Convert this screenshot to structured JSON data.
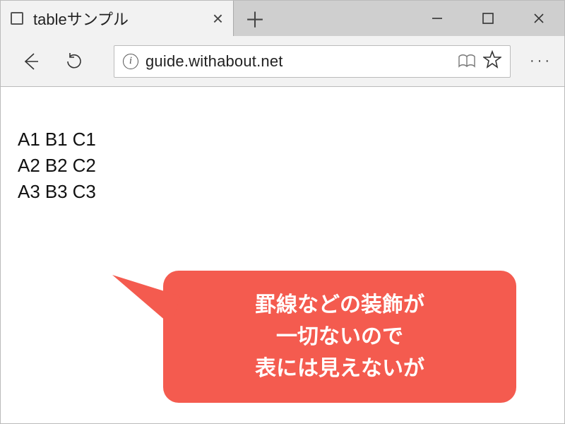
{
  "tab": {
    "title": "tableサンプル"
  },
  "url": "guide.withabout.net",
  "table": {
    "rows": [
      {
        "c0": "A1",
        "c1": "B1",
        "c2": "C1"
      },
      {
        "c0": "A2",
        "c1": "B2",
        "c2": "C2"
      },
      {
        "c0": "A3",
        "c1": "B3",
        "c2": "C3"
      }
    ]
  },
  "callout": {
    "line1": "罫線などの装飾が",
    "line2": "一切ないので",
    "line3": "表には見えないが"
  }
}
